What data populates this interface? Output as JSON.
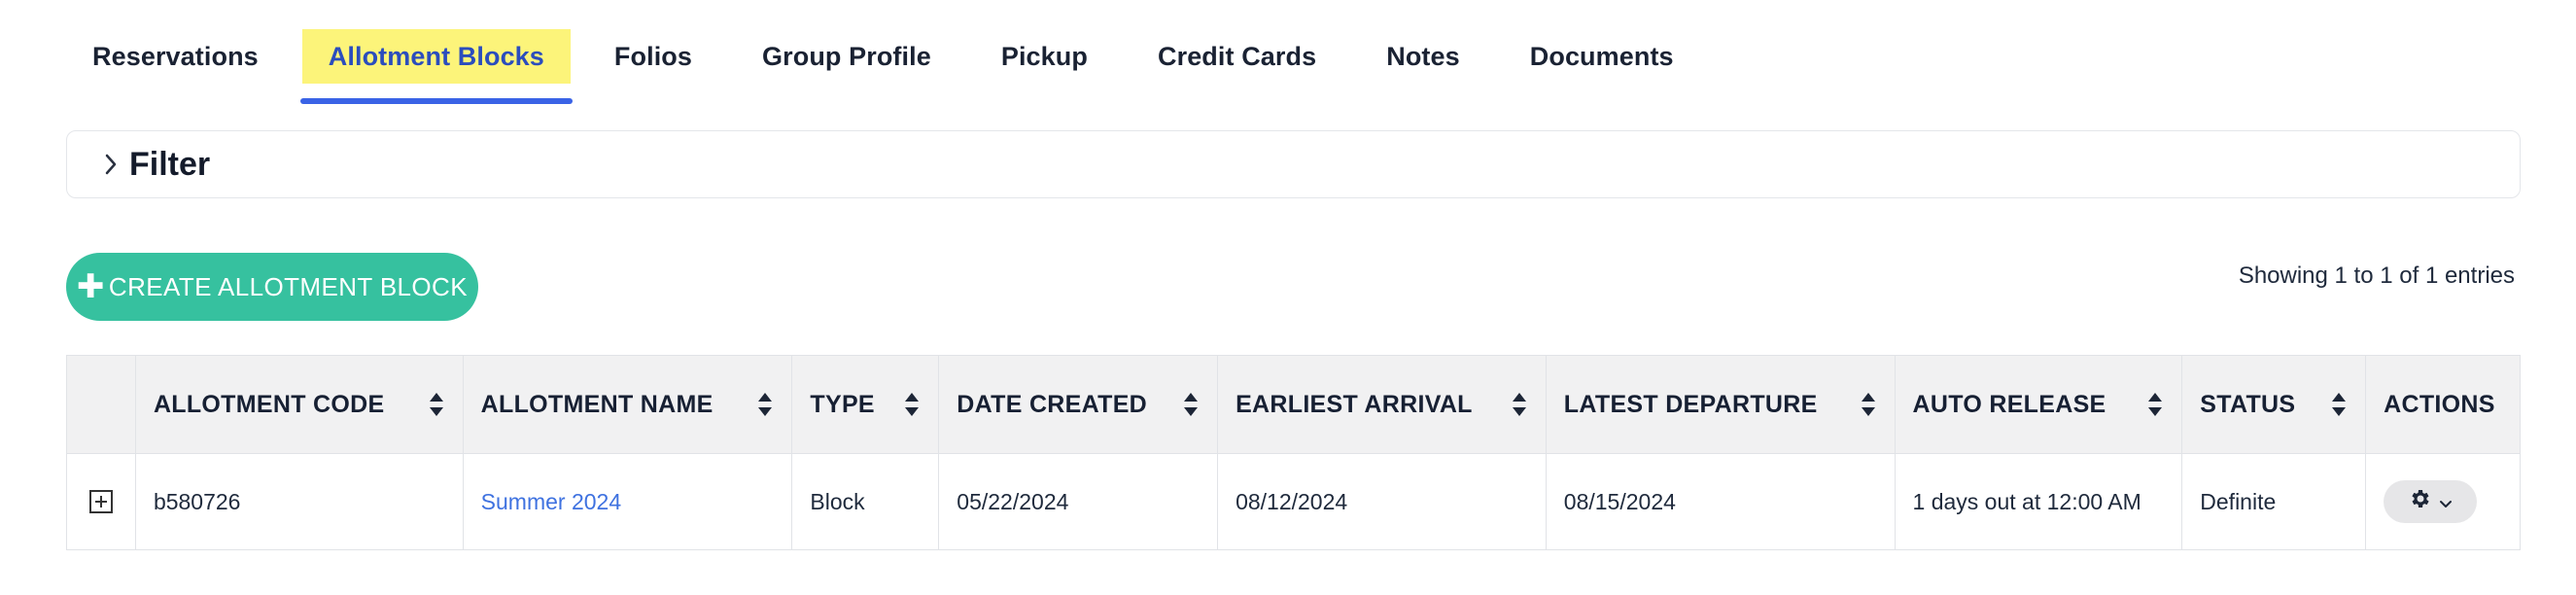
{
  "tabs": [
    {
      "label": "Reservations",
      "active": false
    },
    {
      "label": "Allotment Blocks",
      "active": true
    },
    {
      "label": "Folios",
      "active": false
    },
    {
      "label": "Group Profile",
      "active": false
    },
    {
      "label": "Pickup",
      "active": false
    },
    {
      "label": "Credit Cards",
      "active": false
    },
    {
      "label": "Notes",
      "active": false
    },
    {
      "label": "Documents",
      "active": false
    }
  ],
  "filter": {
    "label": "Filter",
    "icon": "chevron-right-icon"
  },
  "create_button": {
    "label": "CREATE ALLOTMENT BLOCK",
    "icon": "plus-icon"
  },
  "entries_info": "Showing 1 to 1 of 1 entries",
  "table": {
    "columns": [
      "ALLOTMENT CODE",
      "ALLOTMENT NAME",
      "TYPE",
      "DATE CREATED",
      "EARLIEST ARRIVAL",
      "LATEST DEPARTURE",
      "AUTO RELEASE",
      "STATUS",
      "ACTIONS"
    ],
    "rows": [
      {
        "code": "b580726",
        "name": "Summer 2024",
        "type": "Block",
        "date_created": "05/22/2024",
        "earliest_arrival": "08/12/2024",
        "latest_departure": "08/15/2024",
        "auto_release": "1 days out at 12:00 AM",
        "status": "Definite"
      }
    ]
  },
  "colors": {
    "active_tab_bg": "#fcf47a",
    "active_tab_underline": "#3a63e6",
    "create_button_bg": "#36c19f",
    "link": "#3f72e0",
    "header_bg": "#f1f1f2"
  }
}
